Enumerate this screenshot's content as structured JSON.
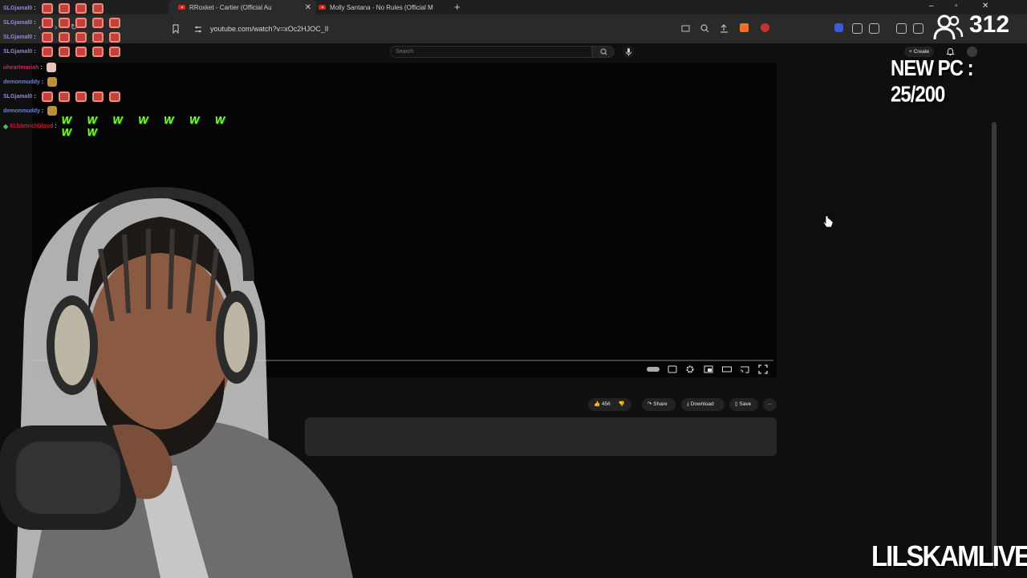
{
  "browser": {
    "tabs": [
      {
        "label": "RRoxket - Cartier (Official Au"
      },
      {
        "label": "Molly Santana - No Rules (Official M"
      }
    ],
    "new_tab": "+",
    "close": "✕",
    "address": "youtube.com/watch?v=xOc2HJOC_lI"
  },
  "youtube": {
    "search_placeholder": "Search",
    "create_label": "Create",
    "actions": {
      "likes": "456",
      "share": "Share",
      "download": "Download",
      "save": "Save",
      "more": "···"
    }
  },
  "chat": {
    "lines": [
      {
        "user": "SLGjamal0",
        "color": "#9b7cff",
        "emotes": 4
      },
      {
        "user": "SLGjamal0",
        "color": "#9b7cff",
        "emotes": 5
      },
      {
        "user": "SLGjamal0",
        "color": "#9b7cff",
        "emotes": 5
      },
      {
        "user": "SLGjamal0",
        "color": "#9b7cff",
        "emotes": 5
      },
      {
        "user": "uheartmariah",
        "color": "#d0245a",
        "emotes": 0
      },
      {
        "user": "demonmuddy",
        "color": "#6e7fd8",
        "emotes": 0
      },
      {
        "user": "SLGjamal0",
        "color": "#9b7cff",
        "emotes": 5
      },
      {
        "user": "demonmuddy",
        "color": "#6e7fd8",
        "emotes": 0
      },
      {
        "user": "813detrichblood",
        "color": "#c02030",
        "emotes": 0
      }
    ],
    "w_spam": "W W W W W W W W W"
  },
  "overlay": {
    "viewer_count": "312",
    "goal_text": "NEW PC : 25/200",
    "brand": "LILSKAMLIVE"
  },
  "icons": [
    "youtube-icon",
    "reload-icon",
    "back-icon",
    "forward-icon",
    "bookmark-icon",
    "site-info-icon",
    "search-icon",
    "mic-icon",
    "bell-icon",
    "like-icon",
    "dislike-icon",
    "share-icon",
    "download-icon",
    "save-icon",
    "settings-icon",
    "captions-icon",
    "fullscreen-icon",
    "viewers-icon",
    "hand-cursor-icon"
  ],
  "colors": {
    "youtube_red": "#e62117",
    "chat_green": "#7dff34",
    "slg_purple": "#9b7cff"
  }
}
